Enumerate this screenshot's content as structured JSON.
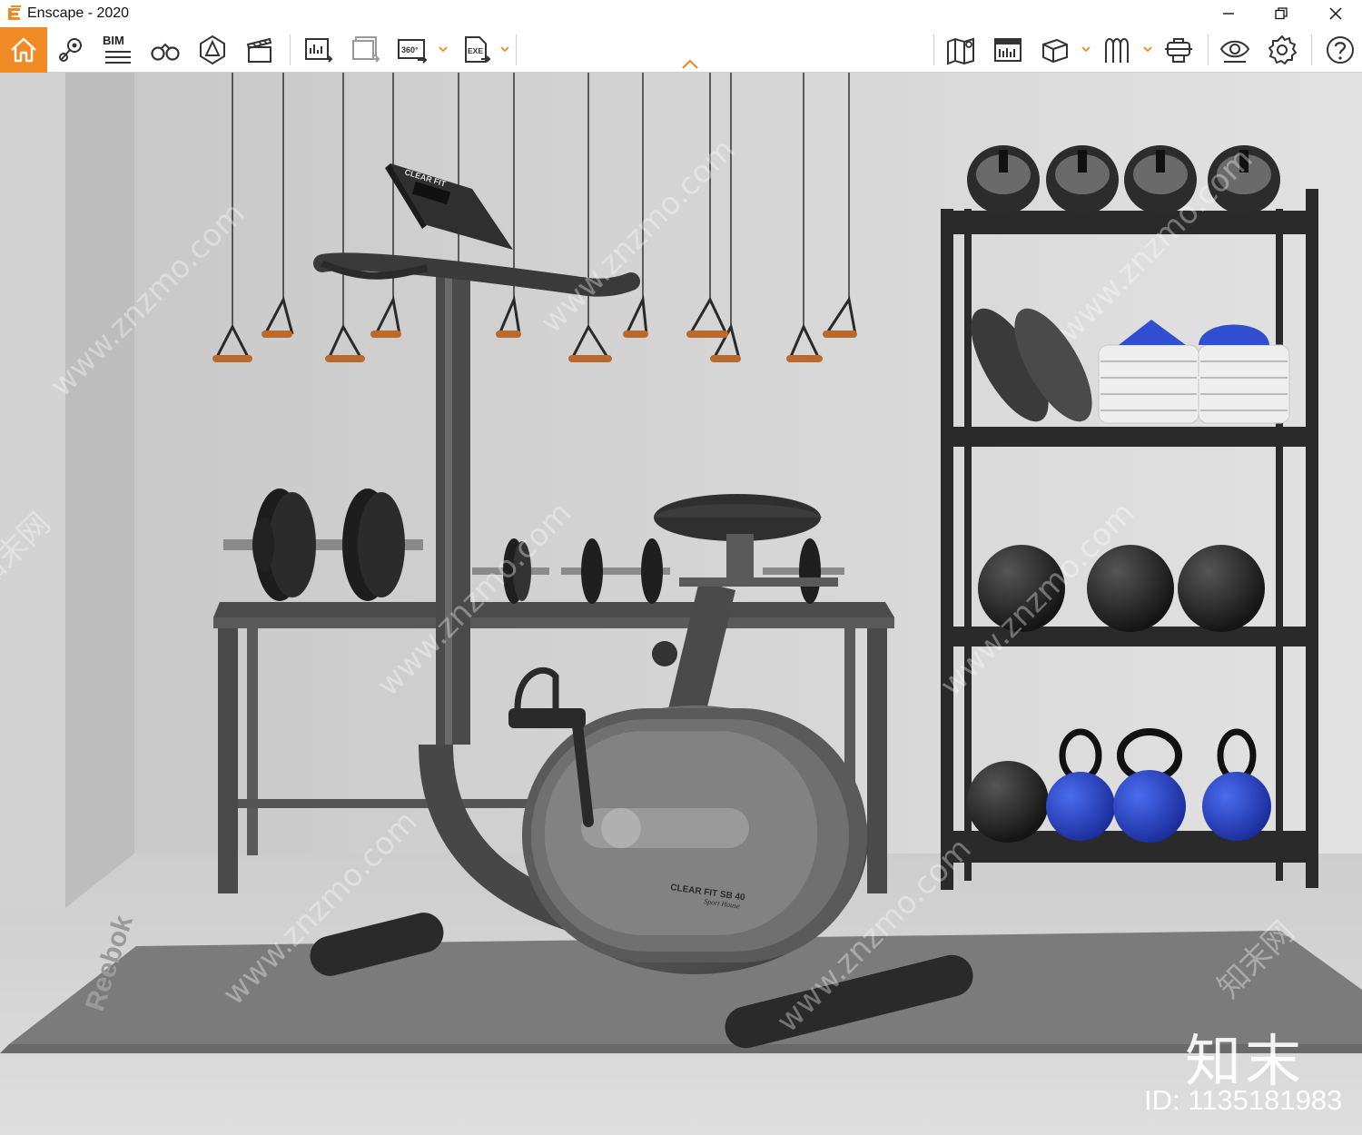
{
  "window": {
    "title": "Enscape - 2020",
    "controls": [
      "minimize-icon",
      "restore-icon",
      "close-icon"
    ]
  },
  "toolbar": {
    "accent_color": "#f08a24",
    "left_tools": [
      "home-icon",
      "map-pin-icon",
      "bim-icon",
      "binoculars-icon",
      "asset-library-icon",
      "video-editor-icon",
      "render-screenshot-icon",
      "batch-render-icon",
      "panorama-360-icon",
      "export-exe-icon"
    ],
    "bim_label": "BIM",
    "pano_label": "360°",
    "exe_label": "EXE",
    "right_tools": [
      "minimap-icon",
      "ruler-panel-icon",
      "cube-view-icon",
      "reflections-icon",
      "capture-icon",
      "visual-settings-icon",
      "settings-gear-icon",
      "help-icon"
    ],
    "collapse_icon": "chevron-up-icon"
  },
  "viewport": {
    "watermark_site": "www.znzmo.com",
    "watermark_brand": "知末网",
    "logo_text": "知末",
    "image_id": "ID: 1135181983",
    "console_brand": "CLEAR FIT",
    "bike_label": "CLEAR FIT SB 40",
    "bike_sublabel": "Sport House",
    "mat_brand": "Reebok"
  }
}
